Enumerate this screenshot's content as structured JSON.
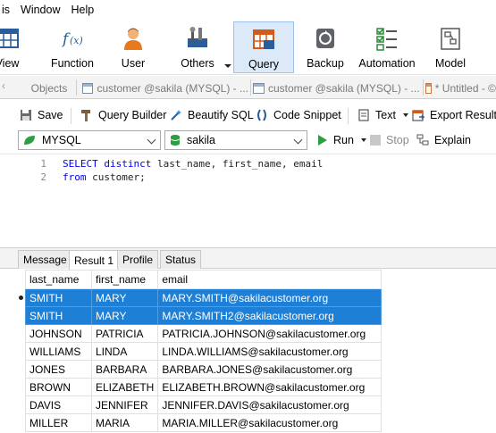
{
  "menubar": {
    "items": [
      "is",
      "Window",
      "Help"
    ]
  },
  "toolbar": {
    "buttons": [
      {
        "label": "View",
        "icon": "table-view-icon"
      },
      {
        "label": "Function",
        "icon": "function-fx-icon"
      },
      {
        "label": "User",
        "icon": "user-icon"
      },
      {
        "label": "Others",
        "icon": "tools-icon"
      },
      {
        "label": "Query",
        "icon": "query-grid-icon",
        "active": true
      },
      {
        "label": "Backup",
        "icon": "backup-icon"
      },
      {
        "label": "Automation",
        "icon": "automation-checklist-icon"
      },
      {
        "label": "Model",
        "icon": "model-icon"
      }
    ]
  },
  "tabs": {
    "objects": "Objects",
    "items": [
      "customer @sakila (MYSQL) - ...",
      "customer @sakila (MYSQL) - ...",
      "* Untitled - ©"
    ]
  },
  "query_toolbar": {
    "save": "Save",
    "query_builder": "Query Builder",
    "beautify": "Beautify SQL",
    "snippet": "Code Snippet",
    "text": "Text",
    "export": "Export Result"
  },
  "connection": {
    "server": "MYSQL",
    "database": "sakila",
    "run": "Run",
    "stop": "Stop",
    "explain": "Explain"
  },
  "editor": {
    "lines": [
      {
        "num": "1",
        "kw": "SELECT distinct",
        "rest": " last_name, first_name, email"
      },
      {
        "num": "2",
        "kw": "from",
        "rest": " customer;"
      }
    ]
  },
  "result_tabs": [
    "Message",
    "Result 1",
    "Profile",
    "Status"
  ],
  "grid": {
    "columns": [
      "last_name",
      "first_name",
      "email"
    ],
    "rows": [
      [
        "SMITH",
        "MARY",
        "MARY.SMITH@sakilacustomer.org"
      ],
      [
        "SMITH",
        "MARY",
        "MARY.SMITH2@sakilacustomer.org"
      ],
      [
        "JOHNSON",
        "PATRICIA",
        "PATRICIA.JOHNSON@sakilacustomer.org"
      ],
      [
        "WILLIAMS",
        "LINDA",
        "LINDA.WILLIAMS@sakilacustomer.org"
      ],
      [
        "JONES",
        "BARBARA",
        "BARBARA.JONES@sakilacustomer.org"
      ],
      [
        "BROWN",
        "ELIZABETH",
        "ELIZABETH.BROWN@sakilacustomer.org"
      ],
      [
        "DAVIS",
        "JENNIFER",
        "JENNIFER.DAVIS@sakilacustomer.org"
      ],
      [
        "MILLER",
        "MARIA",
        "MARIA.MILLER@sakilacustomer.org"
      ]
    ]
  },
  "colors": {
    "selection": "#1e7fd6",
    "active_toolbar": "#dbe9f8",
    "keyword": "#0000e6"
  }
}
